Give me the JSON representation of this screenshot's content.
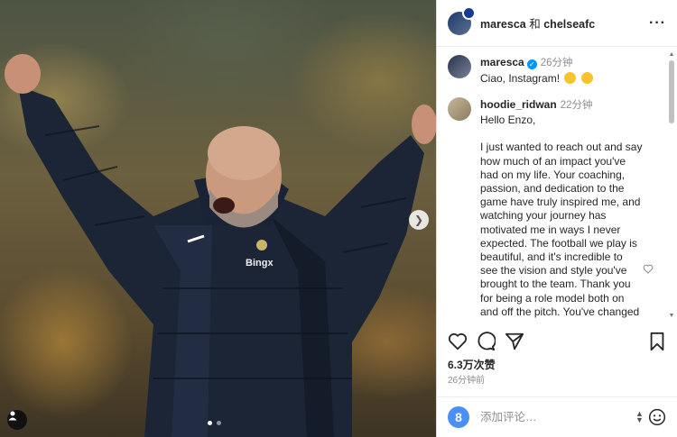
{
  "photo": {
    "next_icon": "chevron-right-icon",
    "user_tag_icon": "person-icon",
    "sponsor_text": "Bingx",
    "carousel_dots": 2,
    "carousel_active": 0
  },
  "header": {
    "username": "maresca",
    "connector": "和",
    "collaborator": "chelseafc",
    "more_icon": "more-horizontal-icon"
  },
  "caption": {
    "username": "maresca",
    "verified": true,
    "time": "26分钟",
    "text": "Ciao, Instagram!"
  },
  "comments": [
    {
      "username": "hoodie_ridwan",
      "time": "22分钟",
      "text": "Hello Enzo,\n\nI just wanted to reach out and say how much of an impact you've had on my life. Your coaching, passion, and dedication to the game have truly inspired me, and watching your journey has motivated me in ways I never expected. The football we play is beautiful, and it's incredible to see the vision and style you've brought to the team. Thank you for being a role model both on and off the pitch. You've changed my life for the"
    }
  ],
  "actions": {
    "like_icon": "heart-icon",
    "comment_icon": "comment-icon",
    "share_icon": "send-icon",
    "save_icon": "bookmark-icon"
  },
  "likes": "6.3万次赞",
  "posted": "26分钟前",
  "add_comment": {
    "placeholder": "添加评论…",
    "emoji_icon": "smiley-icon"
  },
  "colors": {
    "verified": "#0095f6",
    "secondary_text": "#8e8e8e",
    "border": "#dbdbdb"
  }
}
